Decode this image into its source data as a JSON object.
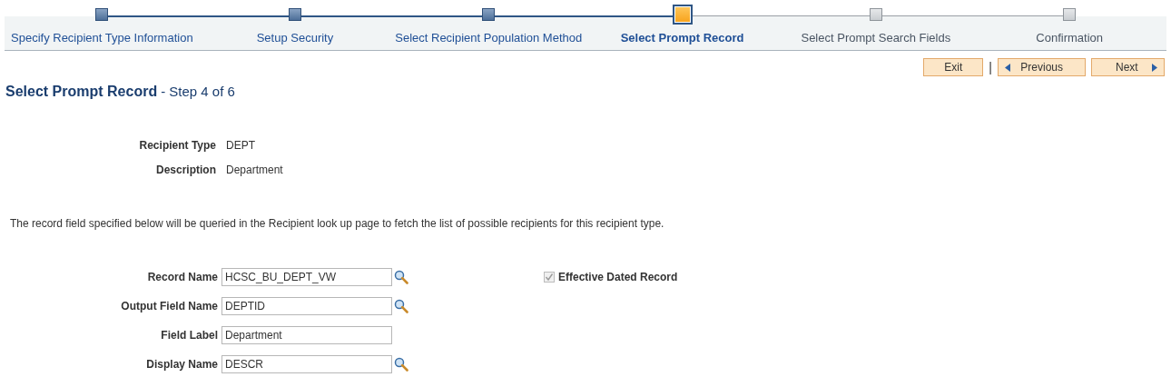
{
  "steps": [
    {
      "label": "Specify Recipient Type Information",
      "complete": true,
      "selected": false
    },
    {
      "label": "Setup Security",
      "complete": true,
      "selected": false
    },
    {
      "label": "Select Recipient Population Method",
      "complete": true,
      "selected": false
    },
    {
      "label": "Select Prompt Record",
      "complete": false,
      "selected": true
    },
    {
      "label": "Select Prompt Search Fields",
      "complete": false,
      "selected": false
    },
    {
      "label": "Confirmation",
      "complete": false,
      "selected": false
    }
  ],
  "nav": {
    "exit": "Exit",
    "separator": "|",
    "previous": "Previous",
    "next": "Next"
  },
  "page_title": {
    "title": "Select Prompt Record",
    "step": "- Step 4 of 6"
  },
  "info": [
    {
      "label": "Recipient Type",
      "value": "DEPT"
    },
    {
      "label": "Description",
      "value": "Department"
    }
  ],
  "note": "The record field specified below will be queried in the Recipient look up page to fetch the list of possible recipients for this recipient type.",
  "fields": [
    {
      "label": "Record Name",
      "value": "HCSC_BU_DEPT_VW",
      "lookup": true
    },
    {
      "label": "Output Field Name",
      "value": "DEPTID",
      "lookup": true
    },
    {
      "label": "Field Label",
      "value": "Department",
      "lookup": false
    },
    {
      "label": "Display Name",
      "value": "DESCR",
      "lookup": true
    }
  ],
  "effective_dated": {
    "label": "Effective Dated Record",
    "checked": true,
    "disabled": true
  }
}
